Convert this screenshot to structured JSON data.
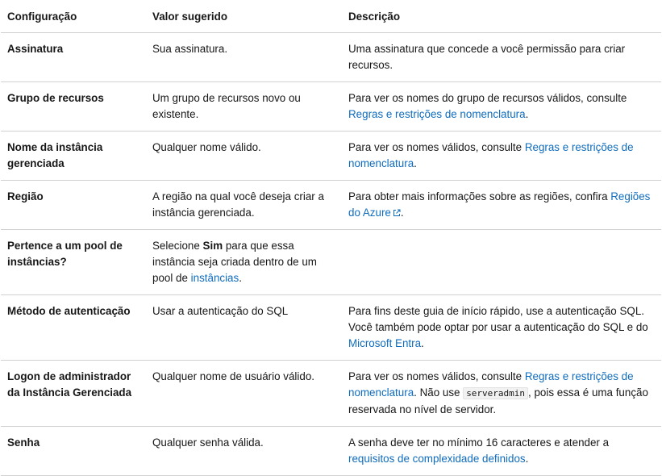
{
  "headers": [
    "Configuração",
    "Valor sugerido",
    "Descrição"
  ],
  "rows": [
    {
      "name": "Assinatura",
      "value": "Sua assinatura.",
      "desc": "Uma assinatura que concede a você permissão para criar recursos."
    },
    {
      "name": "Grupo de recursos",
      "value": "Um grupo de recursos novo ou existente.",
      "desc_pre": "Para ver os nomes do grupo de recursos válidos, consulte ",
      "desc_link": "Regras e restrições de nomenclatura",
      "desc_post": "."
    },
    {
      "name": "Nome da instância gerenciada",
      "value": "Qualquer nome válido.",
      "desc_pre": "Para ver os nomes válidos, consulte ",
      "desc_link": "Regras e restrições de nomenclatura",
      "desc_post": "."
    },
    {
      "name": "Região",
      "value": "A região na qual você deseja criar a instância gerenciada.",
      "desc_pre": "Para obter mais informações sobre as regiões, confira ",
      "desc_link": "Regiões do Azure",
      "desc_post": "."
    },
    {
      "name": "Pertence a um pool de instâncias?",
      "value_pre": "Selecione ",
      "value_bold": "Sim",
      "value_mid": " para que essa instância seja criada dentro de um pool de ",
      "value_link": "instâncias",
      "value_post": ".",
      "desc": ""
    },
    {
      "name": "Método de autenticação",
      "value": "Usar a autenticação do SQL",
      "desc_pre": "Para fins deste guia de início rápido, use a autenticação SQL. Você também pode optar por usar a autenticação do SQL e do ",
      "desc_link": "Microsoft Entra",
      "desc_post": "."
    },
    {
      "name": "Logon de administrador da Instância Gerenciada",
      "value": "Qualquer nome de usuário válido.",
      "desc_pre": "Para ver os nomes válidos, consulte ",
      "desc_link": "Regras e restrições de nomenclatura",
      "desc_mid": ". Não use ",
      "desc_code": "serveradmin",
      "desc_post": ", pois essa é uma função reservada no nível de servidor."
    },
    {
      "name": "Senha",
      "value": "Qualquer senha válida.",
      "desc_pre": "A senha deve ter no mínimo 16 caracteres e atender a ",
      "desc_link": "requisitos de complexidade definidos",
      "desc_post": "."
    }
  ],
  "colors": {
    "link": "#0f6cbd",
    "border": "#d1d1d1",
    "text": "#171717"
  },
  "icons": {
    "external": "external-link-icon"
  }
}
